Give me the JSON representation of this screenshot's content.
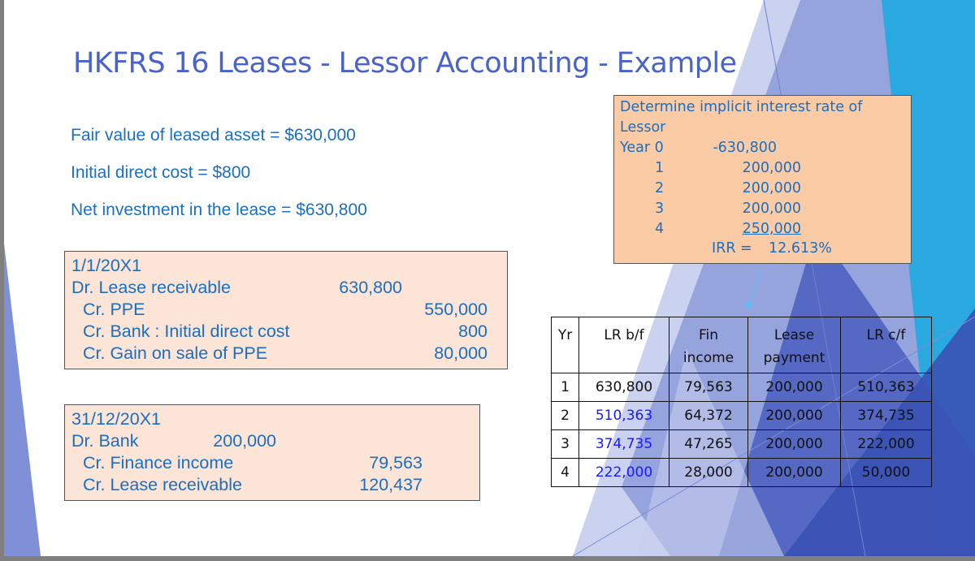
{
  "title": "HKFRS 16 Leases - Lessor Accounting - Example",
  "facts": [
    "Fair value of leased asset = $630,000",
    "Initial direct cost = $800",
    "Net investment in the lease = $630,800"
  ],
  "journal_initial": {
    "date": "1/1/20X1",
    "lines": [
      {
        "account": "Dr. Lease receivable",
        "debit": "630,800",
        "credit": ""
      },
      {
        "account": "Cr. PPE",
        "debit": "",
        "credit": "550,000"
      },
      {
        "account": "Cr. Bank : Initial direct cost",
        "debit": "",
        "credit": "800"
      },
      {
        "account": "Cr. Gain on sale of PPE",
        "debit": "",
        "credit": "80,000"
      }
    ]
  },
  "journal_yearend": {
    "date": "31/12/20X1",
    "lines": [
      {
        "account": "Dr. Bank",
        "debit": "200,000",
        "credit": ""
      },
      {
        "account": "Cr. Finance income",
        "debit": "",
        "credit": "79,563"
      },
      {
        "account": "Cr. Lease receivable",
        "debit": "",
        "credit": "120,437"
      }
    ]
  },
  "irr_box": {
    "heading_line1": "Determine implicit interest rate of",
    "heading_line2": "Lessor",
    "year0_label": "Year 0",
    "cashflows": [
      {
        "year": "",
        "amount": "-630,800"
      },
      {
        "year": "1",
        "amount": "200,000"
      },
      {
        "year": "2",
        "amount": "200,000"
      },
      {
        "year": "3",
        "amount": "200,000"
      },
      {
        "year": "4",
        "amount": "250,000"
      }
    ],
    "irr_label": "IRR =",
    "irr_value": "12.613%"
  },
  "schedule": {
    "headers": {
      "yr": "Yr",
      "lr_bf": "LR b/f",
      "fin_income_1": "Fin",
      "fin_income_2": "income",
      "lease_payment_1": "Lease",
      "lease_payment_2": "payment",
      "lr_cf": "LR c/f"
    },
    "rows": [
      {
        "yr": "1",
        "lr_bf": "630,800",
        "fin_income": "79,563",
        "lease_payment": "200,000",
        "lr_cf": "510,363"
      },
      {
        "yr": "2",
        "lr_bf": "510,363",
        "fin_income": "64,372",
        "lease_payment": "200,000",
        "lr_cf": "374,735"
      },
      {
        "yr": "3",
        "lr_bf": "374,735",
        "fin_income": "47,265",
        "lease_payment": "200,000",
        "lr_cf": "222,000"
      },
      {
        "yr": "4",
        "lr_bf": "222,000",
        "fin_income": "28,000",
        "lease_payment": "200,000",
        "lr_cf": "50,000"
      }
    ]
  },
  "colors": {
    "title": "#4a63c9",
    "body_text": "#1a6fc0",
    "journal_fill": "#fce4d6",
    "irr_fill": "#fbcba6",
    "highlight_blue": "#1a1aff"
  }
}
